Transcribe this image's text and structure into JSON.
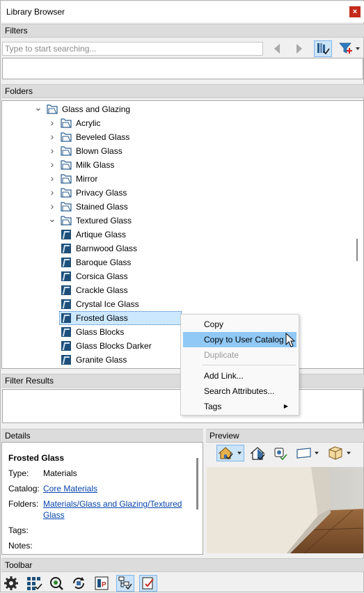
{
  "window": {
    "title": "Library Browser",
    "close_glyph": "×"
  },
  "filters": {
    "header": "Filters",
    "search_placeholder": "Type to start searching..."
  },
  "folders": {
    "header": "Folders",
    "tree": [
      {
        "label": "Glass and Glazing",
        "level": 0,
        "kind": "folder",
        "expanded": true
      },
      {
        "label": "Acrylic",
        "level": 1,
        "kind": "folder",
        "expanded": false
      },
      {
        "label": "Beveled Glass",
        "level": 1,
        "kind": "folder",
        "expanded": false
      },
      {
        "label": "Blown Glass",
        "level": 1,
        "kind": "folder",
        "expanded": false
      },
      {
        "label": "Milk Glass",
        "level": 1,
        "kind": "folder",
        "expanded": false
      },
      {
        "label": "Mirror",
        "level": 1,
        "kind": "folder",
        "expanded": false
      },
      {
        "label": "Privacy Glass",
        "level": 1,
        "kind": "folder",
        "expanded": false
      },
      {
        "label": "Stained Glass",
        "level": 1,
        "kind": "folder",
        "expanded": false
      },
      {
        "label": "Textured Glass",
        "level": 1,
        "kind": "folder",
        "expanded": true
      },
      {
        "label": "Artique Glass",
        "level": 2,
        "kind": "material"
      },
      {
        "label": "Barnwood Glass",
        "level": 2,
        "kind": "material"
      },
      {
        "label": "Baroque Glass",
        "level": 2,
        "kind": "material"
      },
      {
        "label": "Corsica Glass",
        "level": 2,
        "kind": "material"
      },
      {
        "label": "Crackle Glass",
        "level": 2,
        "kind": "material"
      },
      {
        "label": "Crystal Ice Glass",
        "level": 2,
        "kind": "material"
      },
      {
        "label": "Frosted Glass",
        "level": 2,
        "kind": "material",
        "selected": true
      },
      {
        "label": "Glass Blocks",
        "level": 2,
        "kind": "material"
      },
      {
        "label": "Glass Blocks Darker",
        "level": 2,
        "kind": "material"
      },
      {
        "label": "Granite Glass",
        "level": 2,
        "kind": "material"
      }
    ]
  },
  "context_menu": {
    "items": [
      {
        "label": "Copy",
        "state": "normal"
      },
      {
        "label": "Copy to User Catalog",
        "state": "highlighted"
      },
      {
        "label": "Duplicate",
        "state": "disabled"
      },
      {
        "label": "Add Link...",
        "state": "normal"
      },
      {
        "label": "Search Attributes...",
        "state": "normal"
      },
      {
        "label": "Tags",
        "state": "normal",
        "submenu": true
      }
    ],
    "submenu_glyph": "▶"
  },
  "filter_results": {
    "header": "Filter Results"
  },
  "details": {
    "header": "Details",
    "name": "Frosted Glass",
    "type_label": "Type:",
    "type_value": "Materials",
    "catalog_label": "Catalog:",
    "catalog_value": "Core Materials",
    "folders_label": "Folders:",
    "folders_value_line1": "Materials/Glass and Glazing/Textured",
    "folders_value_line2": "Glass",
    "tags_label": "Tags:",
    "notes_label": "Notes:"
  },
  "preview": {
    "header": "Preview",
    "tools": [
      "house-view-icon",
      "house-check-icon",
      "render-icon",
      "surface-icon",
      "box-icon"
    ]
  },
  "toolbar": {
    "header": "Toolbar",
    "tools": [
      "gear-icon",
      "grid-check-icon",
      "refresh-search-icon",
      "sync-icon",
      "parameters-icon",
      "tree-check-icon",
      "checklist-icon"
    ]
  },
  "colors": {
    "accent": "#1e4f7a",
    "selection": "#cce8ff",
    "menu_highlight": "#90c8f6",
    "link": "#0645ad"
  }
}
